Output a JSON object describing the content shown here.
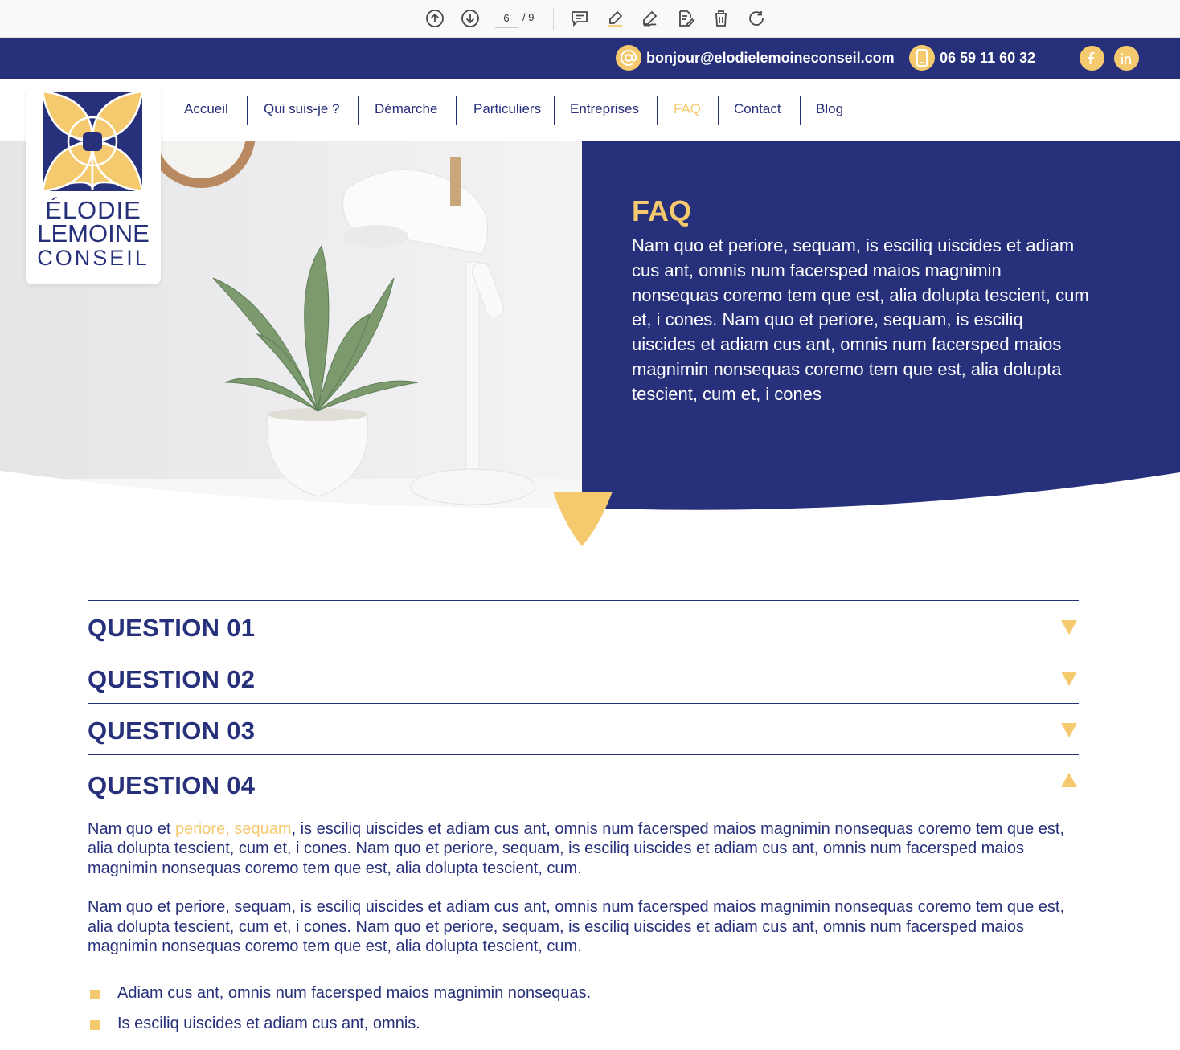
{
  "viewer": {
    "current_page": "6",
    "total_pages": "/ 9",
    "icons": [
      "arrow-up-circle-icon",
      "arrow-down-circle-icon",
      "comment-icon",
      "highlight-icon",
      "draw-icon",
      "edit-page-icon",
      "trash-icon",
      "redo-icon"
    ]
  },
  "topbar": {
    "email": "bonjour@elodielemoineconseil.com",
    "phone": "06 59 11 60 32",
    "socials": [
      "facebook-icon",
      "linkedin-icon"
    ]
  },
  "logo": {
    "line1": "ÉLODIE",
    "line2": "LEMOINE",
    "line3": "CONSEIL"
  },
  "nav": {
    "items": [
      {
        "label": "Accueil"
      },
      {
        "label": "Qui suis-je ?"
      },
      {
        "label": "Démarche"
      },
      {
        "label": "Particuliers"
      },
      {
        "label": "Entreprises"
      },
      {
        "label": "FAQ",
        "active": true
      },
      {
        "label": "Contact"
      },
      {
        "label": "Blog"
      }
    ]
  },
  "hero": {
    "title": "FAQ",
    "text": "Nam quo et periore, sequam, is esciliq uiscides et adiam cus ant, omnis num facersped maios magnimin nonsequas coremo tem que est, alia dolupta tescient, cum et, i cones. Nam quo et periore, sequam, is esciliq uiscides et adiam cus ant, omnis num facersped maios magnimin nonsequas coremo tem que est, alia dolupta tescient, cum et, i cones"
  },
  "faq": {
    "questions": [
      {
        "label": "QUESTION 01",
        "open": false
      },
      {
        "label": "QUESTION 02",
        "open": false
      },
      {
        "label": "QUESTION 03",
        "open": false
      },
      {
        "label": "QUESTION 04",
        "open": true
      }
    ],
    "answer": {
      "p1_before": "Nam quo et ",
      "p1_highlight": "periore, sequam",
      "p1_after": ", is esciliq uiscides et adiam cus ant, omnis num facersped maios magnimin nonsequas coremo tem que est, alia dolupta tescient, cum et, i cones. Nam quo et periore, sequam, is esciliq uiscides et adiam cus ant, omnis num facersped maios magnimin nonsequas coremo tem que est, alia dolupta tescient, cum.",
      "p2": "Nam quo et periore, sequam, is esciliq uiscides et adiam cus ant, omnis num facersped maios magnimin nonsequas coremo tem que est, alia dolupta tescient, cum et, i cones. Nam quo et periore, sequam, is esciliq uiscides et adiam cus ant, omnis num facersped maios magnimin nonsequas coremo tem que est, alia dolupta tescient, cum.",
      "bullets": [
        "Adiam cus ant, omnis num facersped maios magnimin nonsequas.",
        "Is esciliq uiscides et adiam cus ant, omnis."
      ]
    }
  },
  "colors": {
    "navy": "#27307a",
    "gold": "#f5c96d",
    "white": "#ffffff"
  }
}
